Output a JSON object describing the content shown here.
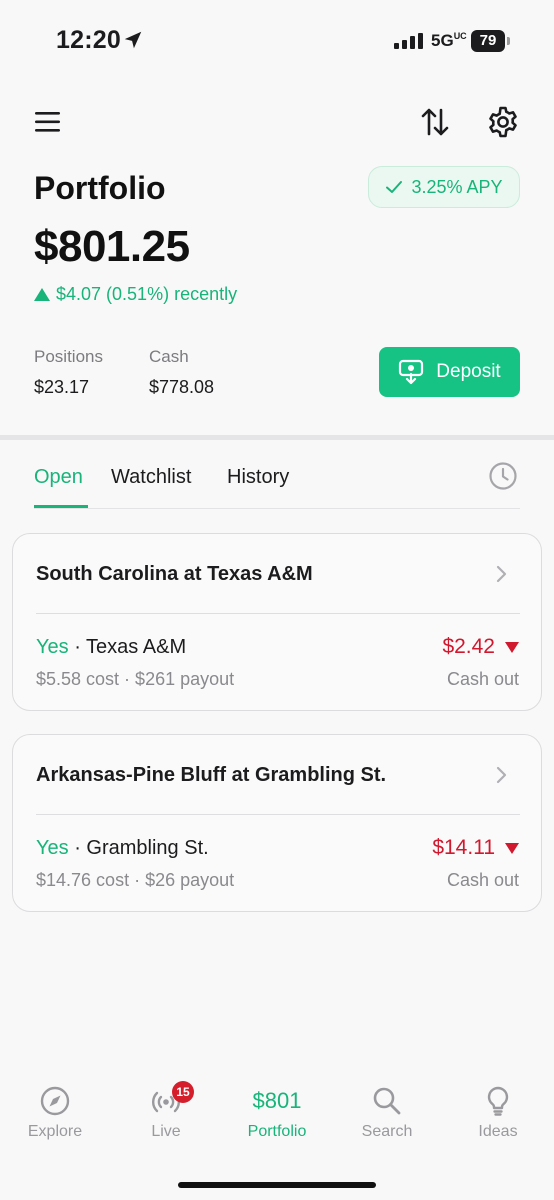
{
  "status_bar": {
    "time": "12:20",
    "network": "5G",
    "network_suffix": "UC",
    "battery": "79"
  },
  "header": {
    "title": "Portfolio",
    "apy_label": "3.25% APY"
  },
  "summary": {
    "balance": "$801.25",
    "change": "$4.07 (0.51%) recently",
    "positions_label": "Positions",
    "positions_value": "$23.17",
    "cash_label": "Cash",
    "cash_value": "$778.08",
    "deposit_label": "Deposit"
  },
  "tabs": [
    {
      "label": "Open",
      "active": true
    },
    {
      "label": "Watchlist",
      "active": false
    },
    {
      "label": "History",
      "active": false
    }
  ],
  "positions": [
    {
      "title": "South Carolina at Texas A&M",
      "side": "Yes",
      "team": "· Texas A&M",
      "detail": "$5.58 cost · $261 payout",
      "value": "$2.42",
      "action": "Cash out"
    },
    {
      "title": "Arkansas-Pine Bluff at Grambling St.",
      "side": "Yes",
      "team": "· Grambling St.",
      "detail": "$14.76 cost · $26 payout",
      "value": "$14.11",
      "action": "Cash out"
    }
  ],
  "nav": {
    "explore": "Explore",
    "live": "Live",
    "live_badge": "15",
    "portfolio_amount": "$801",
    "portfolio": "Portfolio",
    "search": "Search",
    "ideas": "Ideas"
  },
  "colors": {
    "accent": "#16c385",
    "negative": "#d0182e",
    "badge": "#d51e2c"
  }
}
